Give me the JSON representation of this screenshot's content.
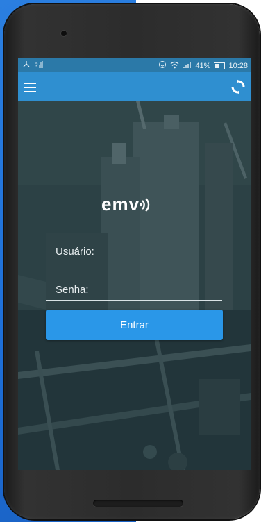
{
  "status_bar": {
    "left_icons": [
      "call-forward-icon",
      "no-sim-signal-icon"
    ],
    "right_icons": [
      "do-not-disturb-icon",
      "wifi-icon",
      "signal-icon",
      "battery-icon"
    ],
    "battery": "41%",
    "time": "10:28"
  },
  "app_bar": {
    "menu_icon": "hamburger-menu-icon",
    "sync_icon": "sync-icon",
    "color": "#2f8fd0"
  },
  "logo": {
    "text": "emv"
  },
  "login": {
    "username_placeholder": "Usuário:",
    "password_placeholder": "Senha:",
    "submit_label": "Entrar",
    "button_color": "#2a97e8"
  }
}
